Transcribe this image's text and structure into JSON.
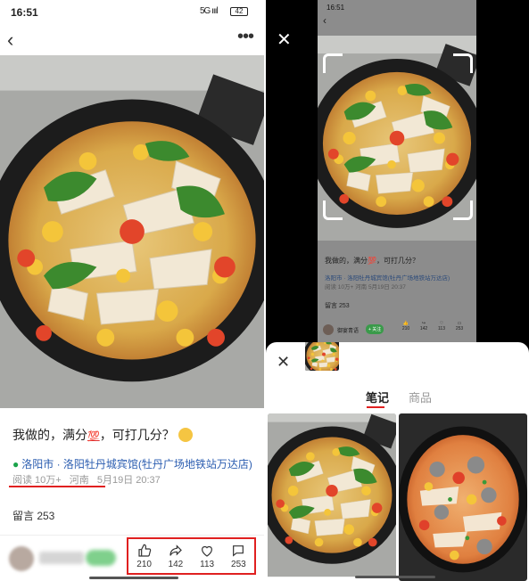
{
  "left": {
    "status_time": "16:51",
    "status_signal": "5G ıııl",
    "battery": "42",
    "back_icon": "chevron-left-icon",
    "more_icon": "more-horizontal-icon",
    "caption_pre": "我做的，满分",
    "caption_badge": "💯",
    "caption_post": "，可打几分？",
    "location": "洛阳市 · 洛阳牡丹城宾馆(牡丹广场地铁站万达店)",
    "meta_reads": "阅读 10万+",
    "meta_region": "河南",
    "meta_date": "5月19日 20:37",
    "comments_label": "留言 253",
    "actions": [
      {
        "icon": "thumbs-up-icon",
        "count": "210"
      },
      {
        "icon": "share-icon",
        "count": "142"
      },
      {
        "icon": "heart-icon",
        "count": "113"
      },
      {
        "icon": "comment-icon",
        "count": "253"
      }
    ]
  },
  "right": {
    "close_icon": "close-icon",
    "mini": {
      "status_time": "16:51",
      "caption": "我做的，满分💯，可打几分？",
      "location": "洛阳市 · 洛阳牡丹城宾馆(牡丹广场地铁站万达店)",
      "meta": "阅读 10万+  河南  5月19日 20:37",
      "comments": "留言 253",
      "author": "御宴青语",
      "follow": "+ 关注",
      "counts": [
        "210",
        "142",
        "113",
        "253"
      ]
    },
    "sheet": {
      "tab_notes": "笔记",
      "tab_products": "商品"
    }
  },
  "colors": {
    "accent_red": "#e02020",
    "location_blue": "#2b5db0",
    "pin_green": "#1aa34a"
  }
}
